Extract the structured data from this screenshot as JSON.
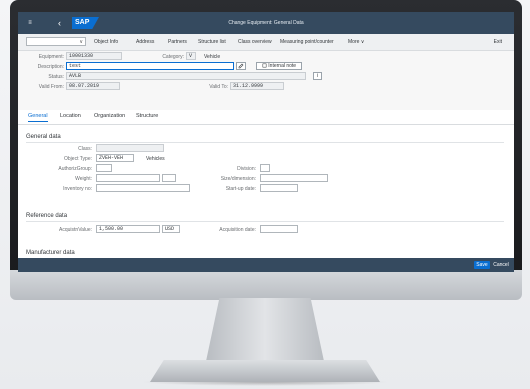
{
  "shell": {
    "menu_glyph": "≡",
    "back_glyph": "‹",
    "logo": "SAP",
    "title": "Change Equipment: General Data"
  },
  "toolbar": {
    "items": [
      "Object Info",
      "Address",
      "Partners",
      "Structure list",
      "Class overview",
      "Measuring point/counter",
      "More"
    ],
    "more_chevron": "∨",
    "exit_label": "Exit"
  },
  "header": {
    "equipment_label": "Equipment:",
    "equipment_value": "10001330",
    "category_label": "Category:",
    "category_value": "V",
    "category_text": "Vehicle",
    "description_label": "Description:",
    "description_value": "test",
    "internal_note_label": "Internal note",
    "status_label": "Status:",
    "status_value": "AVLB",
    "valid_from_label": "Valid From:",
    "valid_from_value": "08.07.2019",
    "valid_to_label": "Valid To:",
    "valid_to_value": "31.12.9999",
    "info_glyph": "i"
  },
  "tabs": [
    "General",
    "Location",
    "Organization",
    "Structure"
  ],
  "general": {
    "section_title": "General data",
    "class_label": "Class:",
    "object_type_label": "Object Type:",
    "object_type_value": "ZVEH-VEH",
    "object_type_text": "Vehicles",
    "auth_group_label": "AuthorizGroup:",
    "weight_label": "Weight:",
    "inventory_label": "Inventory no:",
    "division_label": "Division:",
    "size_label": "Size/dimension:",
    "startup_label": "Start-up date:"
  },
  "reference": {
    "section_title": "Reference data",
    "acq_value_label": "AcquistnValue:",
    "acq_value_value": "1,500.00",
    "currency_value": "USD",
    "acq_date_label": "Acquisition date:"
  },
  "manufacturer": {
    "section_title": "Manufacturer data"
  },
  "footer": {
    "save_label": "Save",
    "cancel_label": "Cancel"
  }
}
